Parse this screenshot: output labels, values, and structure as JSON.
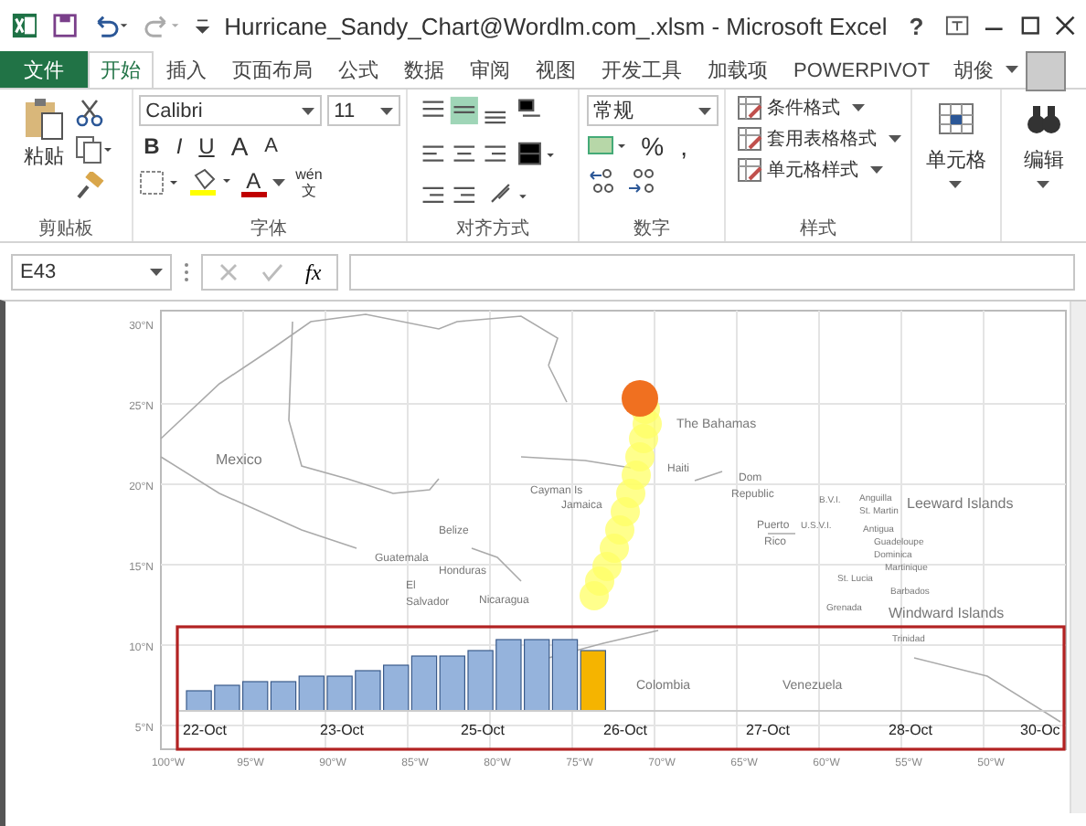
{
  "window": {
    "title": "Hurricane_Sandy_Chart@Wordlm.com_.xlsm - Microsoft Excel",
    "help": "?"
  },
  "tabs": [
    {
      "label": "文件",
      "selected": false,
      "kind": "file"
    },
    {
      "label": "开始",
      "selected": true,
      "kind": "tab"
    },
    {
      "label": "插入",
      "selected": false,
      "kind": "tab"
    },
    {
      "label": "页面布局",
      "selected": false,
      "kind": "tab"
    },
    {
      "label": "公式",
      "selected": false,
      "kind": "tab"
    },
    {
      "label": "数据",
      "selected": false,
      "kind": "tab"
    },
    {
      "label": "审阅",
      "selected": false,
      "kind": "tab"
    },
    {
      "label": "视图",
      "selected": false,
      "kind": "tab"
    },
    {
      "label": "开发工具",
      "selected": false,
      "kind": "tab"
    },
    {
      "label": "加载项",
      "selected": false,
      "kind": "tab"
    },
    {
      "label": "POWERPIVOT",
      "selected": false,
      "kind": "tab"
    }
  ],
  "user": {
    "name": "胡俊"
  },
  "ribbon": {
    "clipboard": {
      "paste": "粘贴",
      "label": "剪贴板"
    },
    "font": {
      "name": "Calibri",
      "size": "11",
      "bold": "B",
      "italic": "I",
      "underline": "U",
      "grow": "A",
      "shrink": "A",
      "color_a": "A",
      "phonetic_top": "wén",
      "phonetic_bottom": "文",
      "label": "字体"
    },
    "alignment": {
      "label": "对齐方式"
    },
    "number": {
      "format": "常规",
      "percent": "%",
      "comma": ",",
      "label": "数字"
    },
    "styles": {
      "items": [
        "条件格式",
        "套用表格格式",
        "单元格样式"
      ],
      "label": "样式"
    },
    "cells": {
      "label": "单元格"
    },
    "editing": {
      "label": "编辑"
    }
  },
  "formula_bar": {
    "name_box": "E43",
    "fx": "fx"
  },
  "map": {
    "lat_labels": [
      "30°N",
      "25°N",
      "20°N",
      "15°N",
      "10°N",
      "5°N"
    ],
    "lon_labels": [
      "100°W",
      "95°W",
      "90°W",
      "85°W",
      "80°W",
      "75°W",
      "70°W",
      "65°W",
      "60°W",
      "55°W",
      "50°W"
    ],
    "places": [
      "Mexico",
      "Belize",
      "Guatemala",
      "Honduras",
      "El",
      "Salvador",
      "Nicaragua",
      "Cayman Is",
      "Jamaica",
      "The Bahamas",
      "Haiti",
      "Dom",
      "Republic",
      "Puerto",
      "Rico",
      "B.V.I.",
      "U.S.V.I.",
      "Anguilla",
      "St. Martin",
      "Leeward Islands",
      "Antigua",
      "Guadeloupe",
      "Dominica",
      "Martinique",
      "St. Lucia",
      "Barbados",
      "Grenada",
      "Windward Islands",
      "Trinidad",
      "Colombia",
      "Venezuela"
    ]
  },
  "timeline": {
    "dates": [
      "22-Oct",
      "23-Oct",
      "25-Oct",
      "26-Oct",
      "27-Oct",
      "28-Oct",
      "30-Oc"
    ]
  }
}
